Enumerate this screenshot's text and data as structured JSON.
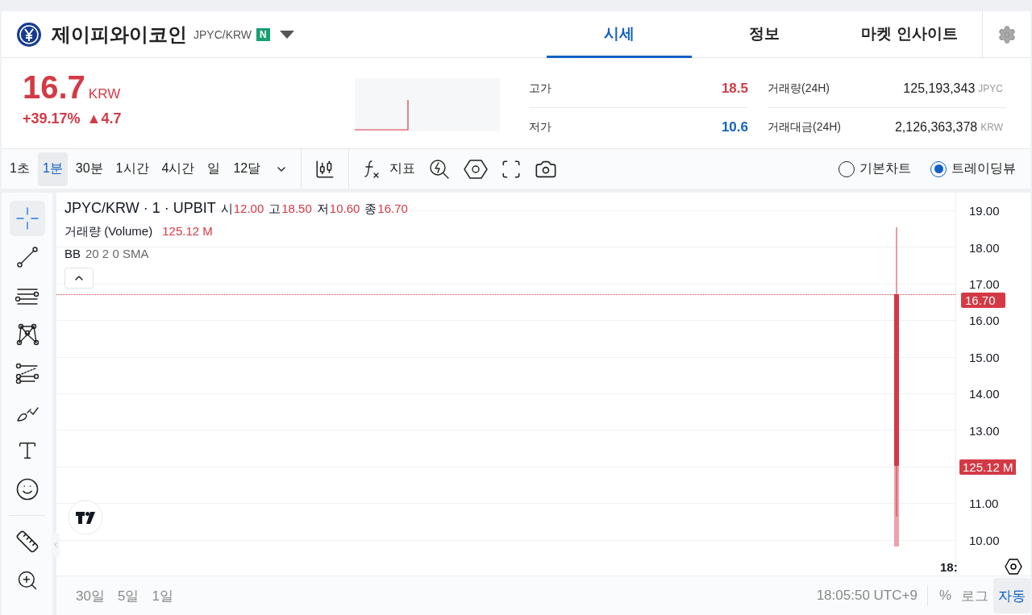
{
  "header": {
    "coin_name": "제이피와이코인",
    "pair": "JPYC/KRW",
    "badge": "N"
  },
  "tabs": [
    {
      "label": "시세",
      "selected": true
    },
    {
      "label": "정보",
      "selected": false
    },
    {
      "label": "마켓 인사이트",
      "selected": false
    }
  ],
  "price": {
    "value": "16.7",
    "unit": "KRW",
    "change_rate": "+39.17%",
    "change_amount": "▲4.7"
  },
  "stats": [
    {
      "label": "고가",
      "value": "18.5",
      "kind": "up"
    },
    {
      "label": "저가",
      "value": "10.6",
      "kind": "down"
    }
  ],
  "volume_stats": [
    {
      "label": "거래량(24H)",
      "value": "125,193,343",
      "unit": "JPYC"
    },
    {
      "label": "거래대금(24H)",
      "value": "2,126,363,378",
      "unit": "KRW"
    }
  ],
  "intervals": [
    {
      "label": "1초",
      "selected": false
    },
    {
      "label": "1분",
      "selected": true
    },
    {
      "label": "30분",
      "selected": false
    },
    {
      "label": "1시간",
      "selected": false
    },
    {
      "label": "4시간",
      "selected": false
    },
    {
      "label": "일",
      "selected": false
    },
    {
      "label": "12달",
      "selected": false
    }
  ],
  "indicator_button": "지표",
  "chart_modes": [
    {
      "label": "기본차트",
      "selected": false
    },
    {
      "label": "트레이딩뷰",
      "selected": true
    }
  ],
  "legend": {
    "symbol": "JPYC/KRW · 1 · UPBIT",
    "ohlc": [
      {
        "label": "시",
        "value": "12.00"
      },
      {
        "label": "고",
        "value": "18.50"
      },
      {
        "label": "저",
        "value": "10.60"
      },
      {
        "label": "종",
        "value": "16.70"
      }
    ],
    "volume_label": "거래량 (Volume)",
    "volume_value": "125.12 M",
    "bb_name": "BB",
    "bb_params": "20 2 0 SMA"
  },
  "drawing_tools": [
    {
      "kind": "crosshair",
      "selected": true
    },
    {
      "kind": "trend-line",
      "selected": false
    },
    {
      "kind": "parallel-lines",
      "selected": false
    },
    {
      "kind": "pattern",
      "selected": false
    },
    {
      "kind": "fib",
      "selected": false
    },
    {
      "kind": "brush",
      "selected": false
    },
    {
      "kind": "text",
      "selected": false
    },
    {
      "kind": "smiley",
      "selected": false
    },
    {
      "kind": "ruler",
      "selected": false
    },
    {
      "kind": "zoom",
      "selected": false
    }
  ],
  "price_axis": [
    {
      "kind": "tick",
      "label": "19.00"
    },
    {
      "kind": "tick",
      "label": "18.00"
    },
    {
      "kind": "tick",
      "label": "17.00"
    },
    {
      "kind": "tick",
      "label": "16.00"
    },
    {
      "kind": "tick",
      "label": "15.00"
    },
    {
      "kind": "tick",
      "label": "14.00"
    },
    {
      "kind": "tick",
      "label": "13.00"
    },
    {
      "kind": "volume",
      "label": "125.12 M"
    },
    {
      "kind": "tick",
      "label": "11.00"
    },
    {
      "kind": "tick",
      "label": "10.00"
    }
  ],
  "last_price_badge": "16.70",
  "time_axis_label": "18:",
  "ranges": [
    "30일",
    "5일",
    "1일"
  ],
  "clock": "18:05:50 UTC+9",
  "scale_buttons": [
    {
      "label": "%",
      "selected": false
    },
    {
      "label": "로그",
      "selected": false
    },
    {
      "label": "자동",
      "selected": true
    }
  ]
}
